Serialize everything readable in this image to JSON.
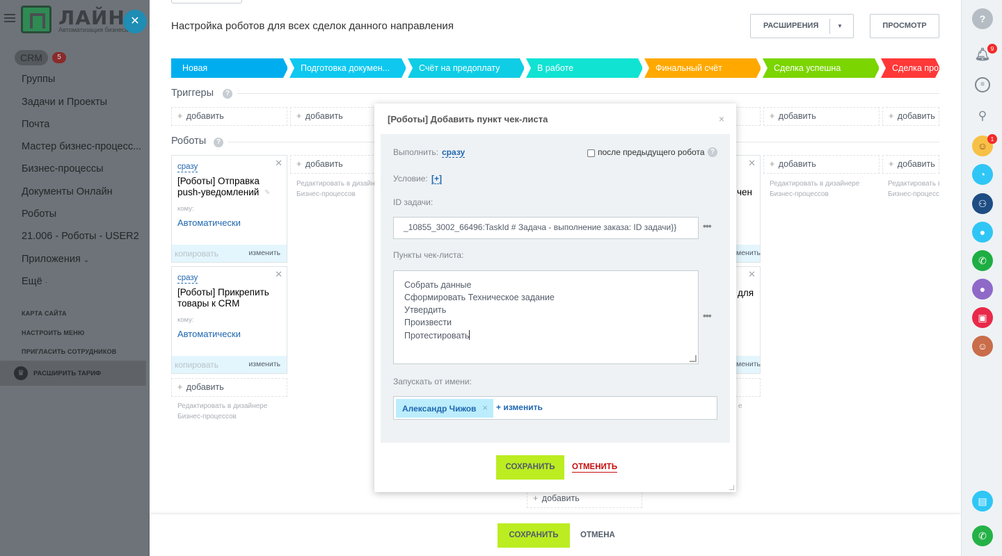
{
  "app": {
    "logo_text": "ЛАЙН",
    "logo_subtitle": "Автоматизация бизнеса"
  },
  "sidebar": {
    "crm_label": "CRM",
    "crm_count": "5",
    "items": [
      "Группы",
      "Задачи и Проекты",
      "Почта",
      "Мастер бизнес-процесс...",
      "Бизнес-процессы",
      "Документы Онлайн",
      "Роботы",
      "21.006 - Роботы - USER2",
      "Приложения",
      "Ещё"
    ],
    "small_links": [
      "КАРТА САЙТА",
      "НАСТРОИТЬ МЕНЮ",
      "ПРИГЛАСИТЬ СОТРУДНИКОВ"
    ],
    "tariff_label": "РАСШИРИТЬ ТАРИФ"
  },
  "header": {
    "title": "Настройка роботов для всех сделок данного направления",
    "extensions_label": "РАСШИРЕНИЯ",
    "preview_label": "ПРОСМОТР"
  },
  "stages": [
    {
      "label": "Новая",
      "color": "#00aeef"
    },
    {
      "label": "Подготовка докумен...",
      "color": "#0ec8f0"
    },
    {
      "label": "Счёт на предоплату",
      "color": "#10cde6"
    },
    {
      "label": "В работе",
      "color": "#11e3d3"
    },
    {
      "label": "Финальный счёт",
      "color": "#ffa900"
    },
    {
      "label": "Сделка успешна",
      "color": "#7bd500"
    },
    {
      "label": "Сделка про",
      "color": "#ff3838"
    }
  ],
  "sections": {
    "triggers": "Триггеры",
    "robots": "Роботы"
  },
  "add_label": "добавить",
  "designer_hint": {
    "line1": "Редактировать в дизайнере",
    "line2": "Бизнес-процессов"
  },
  "robot_cards": [
    {
      "when": "сразу",
      "title": "[Роботы] Отправка push-уведомлений",
      "to_label": "кому:",
      "to_value": "Автоматически",
      "copy_label": "копировать",
      "edit_label": "изменить"
    },
    {
      "when": "сразу",
      "title": "[Роботы] Прикрепить товары к CRM",
      "to_label": "кому:",
      "to_value": "Автоматически",
      "copy_label": "копировать",
      "edit_label": "изменить"
    }
  ],
  "partial_cards": {
    "text1": "чен",
    "text2": "для",
    "edit_label": "изменить"
  },
  "modal": {
    "title": "[Роботы] Добавить пункт чек-листа",
    "execute_label": "Выполнить:",
    "execute_value": "сразу",
    "after_prev_label": "после предыдущего робота",
    "condition_label": "Условие:",
    "condition_value": "[+]",
    "task_id_label": "ID задачи:",
    "task_id_value": "_10855_3002_66496:TaskId # Задача - выполнение заказа: ID задачи}}",
    "checklist_label": "Пункты чек-листа:",
    "checklist_items": [
      "Собрать данные",
      "Сформировать Техническое задание",
      "Утвердить",
      "Произвести",
      "Протестировать"
    ],
    "run_as_label": "Запускать от имени:",
    "run_as_user": "Александр Чижов",
    "change_label": "изменить",
    "save_label": "СОХРАНИТЬ",
    "cancel_label": "ОТМЕНИТЬ"
  },
  "footer": {
    "save_label": "СОХРАНИТЬ",
    "cancel_label": "ОТМЕНА"
  },
  "right_panel": {
    "notifications_count": "9",
    "avatar_badge": "1"
  }
}
